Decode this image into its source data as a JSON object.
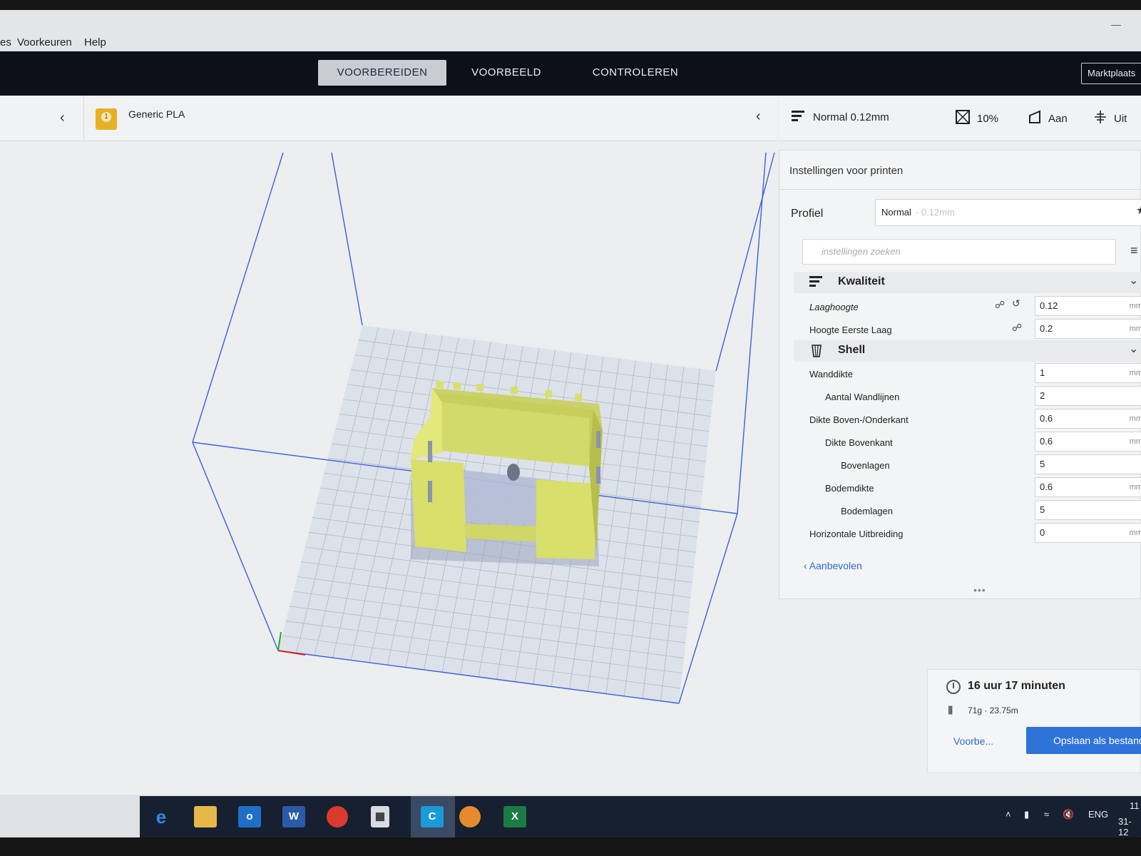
{
  "menu": {
    "items": [
      "es",
      "Voorkeuren",
      "Help"
    ]
  },
  "toolbar": {
    "tabs": [
      "VOORBEREIDEN",
      "VOORBEELD",
      "CONTROLEREN"
    ],
    "marketplace": "Marktplaats"
  },
  "material": {
    "extruder_number": "1",
    "name": "Generic PLA"
  },
  "summary": {
    "profile": "Normal 0.12mm",
    "infill": "10%",
    "support": "Aan",
    "adhesion": "Uit"
  },
  "settings": {
    "title": "Instellingen voor printen",
    "profile_label": "Profiel",
    "profile_value": "Normal",
    "profile_value_faded": "- 0.12mm",
    "search_placeholder": "instellingen zoeken",
    "categories": [
      {
        "label": "Kwaliteit",
        "rows": [
          {
            "label": "Laaghoogte",
            "value": "0.12",
            "unit": "mm"
          },
          {
            "label": "Hoogte Eerste Laag",
            "value": "0.2",
            "unit": "mm"
          }
        ]
      },
      {
        "label": "Shell",
        "rows": [
          {
            "label": "Wanddikte",
            "value": "1",
            "unit": "mm"
          },
          {
            "label": "Aantal Wandlijnen",
            "value": "2",
            "unit": ""
          },
          {
            "label": "Dikte Boven-/Onderkant",
            "value": "0.6",
            "unit": "mm"
          },
          {
            "label": "Dikte Bovenkant",
            "value": "0.6",
            "unit": "mm"
          },
          {
            "label": "Bovenlagen",
            "value": "5",
            "unit": ""
          },
          {
            "label": "Bodemdikte",
            "value": "0.6",
            "unit": "mm"
          },
          {
            "label": "Bodemlagen",
            "value": "5",
            "unit": ""
          },
          {
            "label": "Horizontale Uitbreiding",
            "value": "0",
            "unit": "mm"
          }
        ]
      }
    ],
    "recommended": "Aanbevolen"
  },
  "estimate": {
    "time": "16 uur 17 minuten",
    "material": "71g · 23.75m",
    "preview": "Voorbe...",
    "save": "Opslaan als bestand"
  },
  "taskbar": {
    "language": "ENG",
    "time": "11",
    "date": "31-12"
  },
  "colors": {
    "accent": "#2e73d8",
    "model": "#d8df6a",
    "topbar": "#0c1019",
    "material_badge": "#e7b125"
  }
}
